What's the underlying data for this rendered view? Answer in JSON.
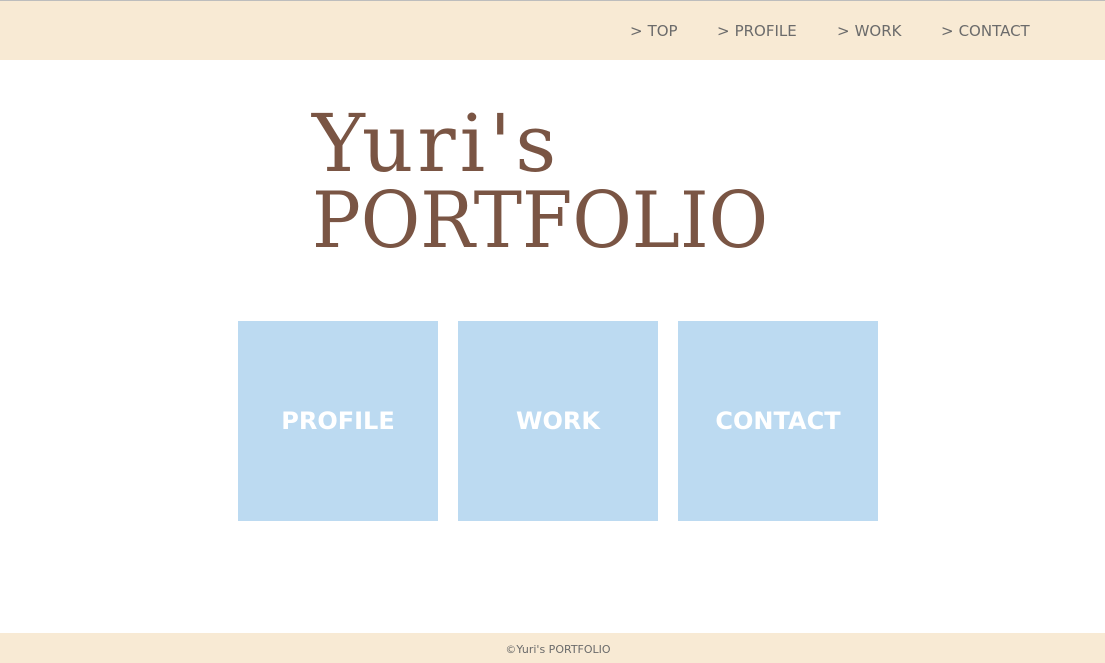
{
  "nav": {
    "arrow": ">",
    "items": [
      {
        "label": "TOP"
      },
      {
        "label": "PROFILE"
      },
      {
        "label": "WORK"
      },
      {
        "label": "CONTACT"
      }
    ]
  },
  "logo": {
    "line1": "Yuri's",
    "line2": "PORTFOLIO"
  },
  "tiles": [
    {
      "label": "PROFILE"
    },
    {
      "label": "WORK"
    },
    {
      "label": "CONTACT"
    }
  ],
  "footer": {
    "copyright": "©Yuri's PORTFOLIO"
  },
  "colors": {
    "header_bg": "#f8ead4",
    "tile_bg": "#bcdaf1",
    "logo_text": "#7a5544",
    "nav_text": "#6b6b6b"
  }
}
